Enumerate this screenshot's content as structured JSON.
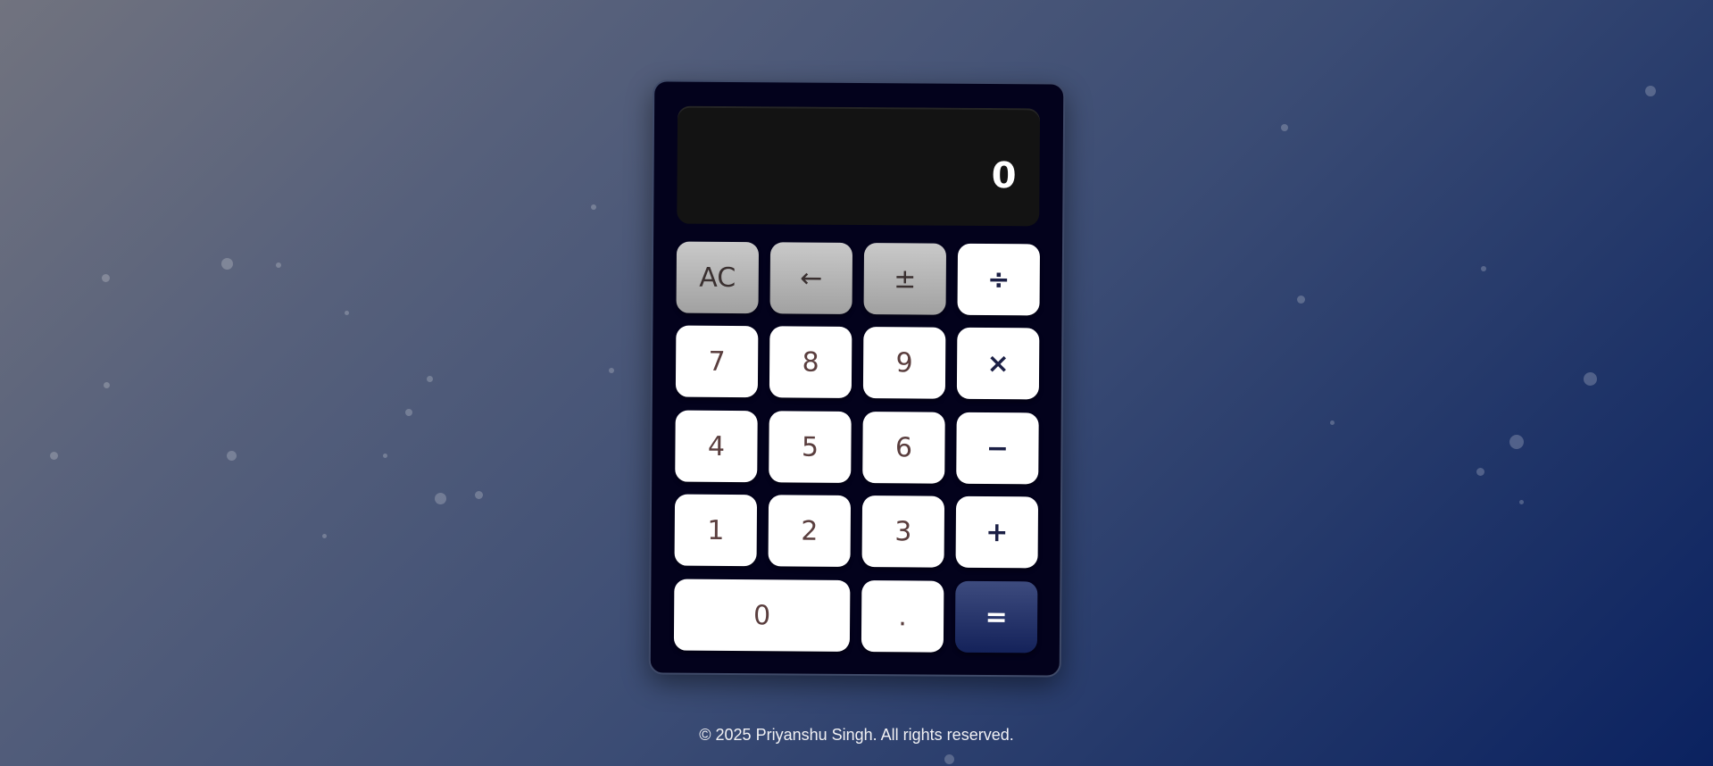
{
  "display": {
    "value": "0"
  },
  "keys": {
    "ac": "AC",
    "backspace": "←",
    "sign": "±",
    "divide": "÷",
    "seven": "7",
    "eight": "8",
    "nine": "9",
    "multiply": "×",
    "four": "4",
    "five": "5",
    "six": "6",
    "subtract": "−",
    "one": "1",
    "two": "2",
    "three": "3",
    "add": "+",
    "zero": "0",
    "decimal": ".",
    "equals": "="
  },
  "footer": {
    "text": "© 2025 Priyanshu Singh. All rights reserved."
  },
  "colors": {
    "calculator_body": "#03021c",
    "display_background": "#131313",
    "equals_key": "#14225a",
    "function_key": "#a1a1a1"
  }
}
